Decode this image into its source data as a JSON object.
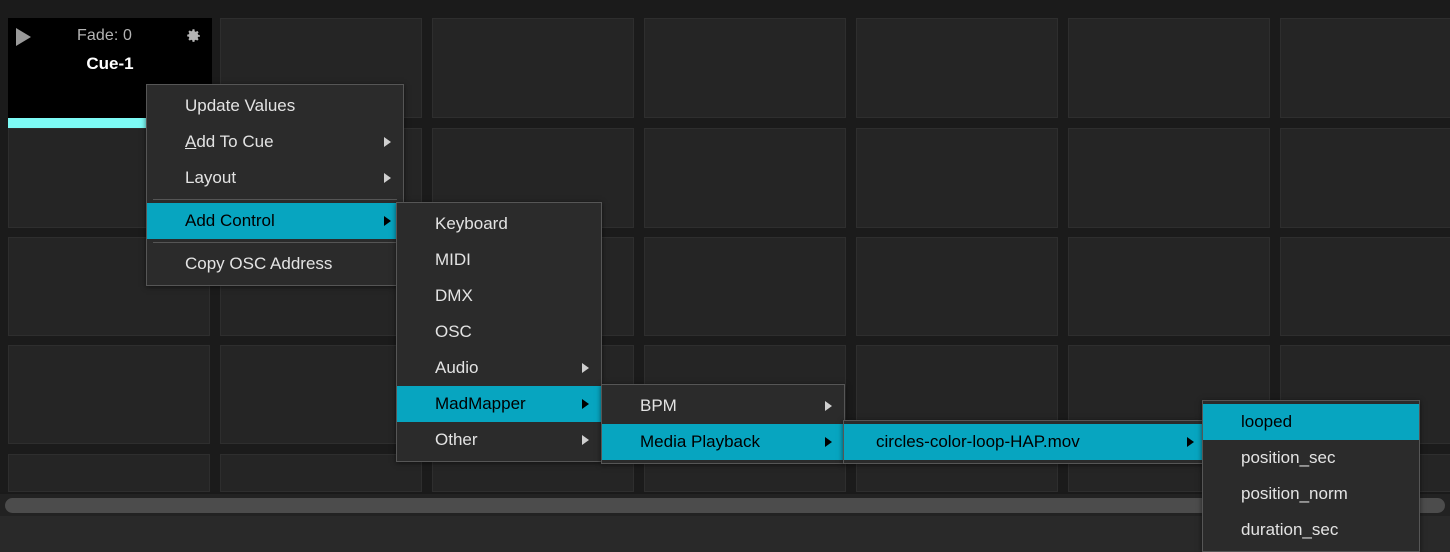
{
  "workspace": {
    "rows": 4,
    "columns": 7,
    "cell_label": ""
  },
  "cue_tile": {
    "play_icon": "play-icon",
    "fade_label": "Fade: 0",
    "gear_icon": "gear-icon",
    "name": "Cue-1",
    "accent_bar_color": "#7dfaf5"
  },
  "colors": {
    "highlight": "#07a5c0",
    "menu_bg": "#2b2b2b",
    "menu_border": "#565656",
    "workspace_bg": "#1b1b1b",
    "cell_bg": "#252525",
    "cue_bar": "#7dfaf5"
  },
  "menus": {
    "context": {
      "name": "cue-context-menu",
      "items": [
        {
          "label": "Update Values",
          "arrow": false,
          "highlight": false,
          "sep_before": false
        },
        {
          "label": "Add To Cue",
          "arrow": true,
          "highlight": false,
          "sep_before": false,
          "accel": "A"
        },
        {
          "label": "Layout",
          "arrow": true,
          "highlight": false,
          "sep_before": false
        },
        {
          "label": "Add Control",
          "arrow": true,
          "highlight": true,
          "sep_before": true
        },
        {
          "label": "Copy OSC Address",
          "arrow": false,
          "highlight": false,
          "sep_before": true
        }
      ]
    },
    "add_control": {
      "name": "add-control-submenu",
      "items": [
        {
          "label": "Keyboard",
          "arrow": false,
          "highlight": false
        },
        {
          "label": "MIDI",
          "arrow": false,
          "highlight": false
        },
        {
          "label": "DMX",
          "arrow": false,
          "highlight": false
        },
        {
          "label": "OSC",
          "arrow": false,
          "highlight": false
        },
        {
          "label": "Audio",
          "arrow": true,
          "highlight": false
        },
        {
          "label": "MadMapper",
          "arrow": true,
          "highlight": true
        },
        {
          "label": "Other",
          "arrow": true,
          "highlight": false
        }
      ]
    },
    "madmapper": {
      "name": "madmapper-submenu",
      "items": [
        {
          "label": "BPM",
          "arrow": true,
          "highlight": false
        },
        {
          "label": "Media Playback",
          "arrow": true,
          "highlight": true
        }
      ]
    },
    "media_playback": {
      "name": "media-playback-submenu",
      "items": [
        {
          "label": "circles-color-loop-HAP.mov",
          "arrow": true,
          "highlight": true
        }
      ]
    },
    "media_properties": {
      "name": "media-properties-submenu",
      "items": [
        {
          "label": "looped",
          "arrow": false,
          "highlight": true
        },
        {
          "label": "position_sec",
          "arrow": false,
          "highlight": false
        },
        {
          "label": "position_norm",
          "arrow": false,
          "highlight": false
        },
        {
          "label": "duration_sec",
          "arrow": false,
          "highlight": false
        }
      ]
    }
  },
  "scrollbar": {
    "name": "horizontal-scrollbar",
    "orientation": "horizontal"
  }
}
